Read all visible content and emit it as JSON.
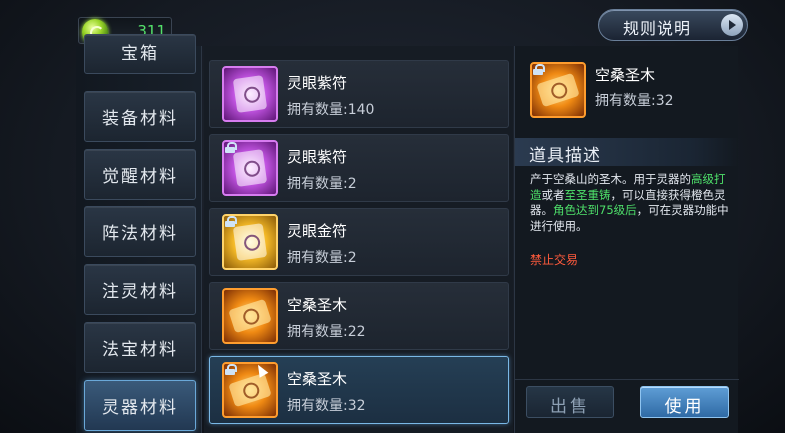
{
  "currency": {
    "icon": "jade-coin-icon",
    "value": "311"
  },
  "rules_button": {
    "label": "规则说明"
  },
  "tabs": [
    {
      "label": "宝箱",
      "active": false
    },
    {
      "label": "装备材料",
      "active": false
    },
    {
      "label": "觉醒材料",
      "active": false
    },
    {
      "label": "阵法材料",
      "active": false
    },
    {
      "label": "注灵材料",
      "active": false
    },
    {
      "label": "法宝材料",
      "active": false
    },
    {
      "label": "灵器材料",
      "active": true
    }
  ],
  "items": [
    {
      "name": "灵眼紫符",
      "count": "拥有数量:140",
      "icon": "purple-talisman-icon",
      "locked": false
    },
    {
      "name": "灵眼紫符",
      "count": "拥有数量:2",
      "icon": "purple-talisman-icon",
      "locked": true
    },
    {
      "name": "灵眼金符",
      "count": "拥有数量:2",
      "icon": "gold-talisman-icon",
      "locked": true
    },
    {
      "name": "空桑圣木",
      "count": "拥有数量:22",
      "icon": "sacred-wood-icon",
      "locked": false
    },
    {
      "name": "空桑圣木",
      "count": "拥有数量:32",
      "icon": "sacred-wood-icon",
      "locked": true,
      "selected": true
    }
  ],
  "detail": {
    "name": "空桑圣木",
    "count": "拥有数量:32",
    "icon": "sacred-wood-icon",
    "section_title": "道具描述",
    "desc_1": "产于空桑山的圣木。用于灵器的",
    "desc_green_1": "高级打造",
    "desc_2": "或者",
    "desc_green_2": "至圣重铸",
    "desc_3": "，可以直接获得橙色灵器。",
    "desc_green_3": "角色达到75级后",
    "desc_4": "，可在灵器功能中进行使用。",
    "no_trade": "禁止交易"
  },
  "buttons": {
    "sell": "出售",
    "use": "使用"
  },
  "colors": {
    "accent": "#6aa8d8",
    "green_text": "#4ee06a",
    "warning": "#ff5a3c",
    "currency_text": "#54e06a"
  }
}
